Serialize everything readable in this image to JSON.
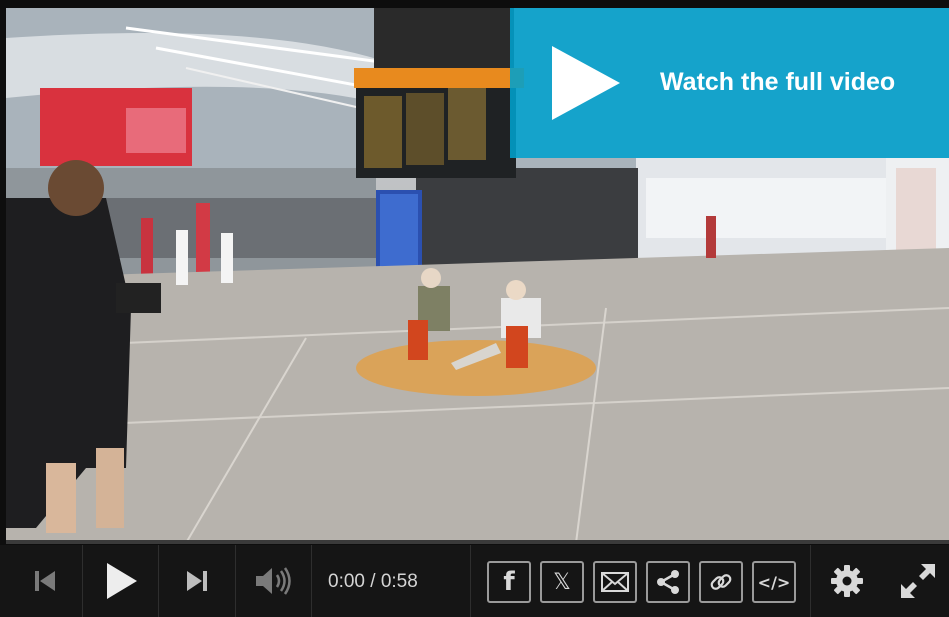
{
  "video": {
    "cta_label": "Watch the full video"
  },
  "player": {
    "time_display": "0:00 / 0:58",
    "progress_fraction": 0
  },
  "share": {
    "facebook_glyph": "f",
    "x_glyph": "𝕏",
    "embed_glyph": "</>"
  },
  "icons": [
    "skip-back-icon",
    "play-icon",
    "skip-forward-icon",
    "volume-icon",
    "facebook-icon",
    "x-icon",
    "email-icon",
    "share-icon",
    "link-icon",
    "embed-icon",
    "settings-icon",
    "fullscreen-icon"
  ],
  "colors": {
    "cta_background": "#00a0cd",
    "control_bar": "#151515"
  }
}
